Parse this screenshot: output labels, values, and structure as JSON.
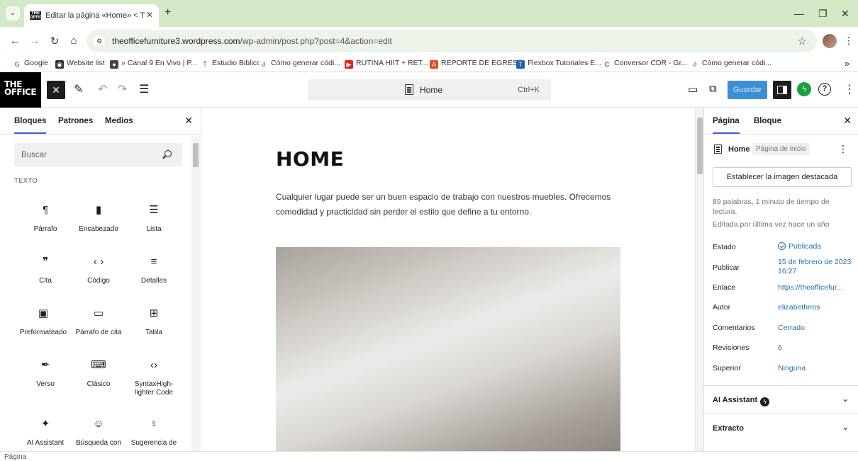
{
  "browser": {
    "tab_title": "Editar la página «Home» < The",
    "favicon_text": "THE OFFICE",
    "url_host": "theofficefurniture3.wordpress.com",
    "url_path": "/wp-admin/post.php?post=4&action=edit",
    "bookmarks": [
      {
        "label": "Google",
        "icon": "google-icon",
        "color": "#4285f4"
      },
      {
        "label": "Website list",
        "icon": "globe-icon",
        "color": "#333333"
      },
      {
        "label": "» Canal 9 En Vivo | P...",
        "icon": "soccer-icon",
        "color": "#444444"
      },
      {
        "label": "Estudio Biblico",
        "icon": "bookmark-icon",
        "color": "#777777"
      },
      {
        "label": "Cómo generar códi...",
        "icon": "link-icon",
        "color": "#555555"
      },
      {
        "label": "RUTINA HIIT + RET...",
        "icon": "youtube-icon",
        "color": "#e62117"
      },
      {
        "label": "REPORTE DE EGRES...",
        "icon": "adobe-icon",
        "color": "#e34826"
      },
      {
        "label": "Flexbox Tutoriales E...",
        "icon": "tl-icon",
        "color": "#1d5fb3"
      },
      {
        "label": "Conversor CDR - Gr...",
        "icon": "c-icon",
        "color": "#d32f2f"
      },
      {
        "label": "Cómo generar códi...",
        "icon": "link-icon",
        "color": "#555555"
      }
    ]
  },
  "editor": {
    "logo_line1": "THE",
    "logo_line2": "OFFICE",
    "command_label": "Home",
    "command_shortcut": "Ctrl+K",
    "save_label": "Guardar"
  },
  "inserter": {
    "tabs": [
      "Bloques",
      "Patrones",
      "Medios"
    ],
    "search_placeholder": "Buscar",
    "section_title": "TEXTO",
    "blocks": [
      {
        "label": "Párrafo",
        "glyph": "¶",
        "icon": "paragraph-icon"
      },
      {
        "label": "Encabezado",
        "glyph": "▮",
        "icon": "heading-icon"
      },
      {
        "label": "Lista",
        "glyph": "☰",
        "icon": "list-icon"
      },
      {
        "label": "Cita",
        "glyph": "❞",
        "icon": "quote-icon"
      },
      {
        "label": "Código",
        "glyph": "‹ ›",
        "icon": "code-icon"
      },
      {
        "label": "Detalles",
        "glyph": "≡",
        "icon": "details-icon"
      },
      {
        "label": "Preformateado",
        "glyph": "▣",
        "icon": "preformatted-icon"
      },
      {
        "label": "Párrafo de cita",
        "glyph": "▭",
        "icon": "pullquote-icon"
      },
      {
        "label": "Tabla",
        "glyph": "⊞",
        "icon": "table-icon"
      },
      {
        "label": "Verso",
        "glyph": "✒",
        "icon": "verse-icon"
      },
      {
        "label": "Clásico",
        "glyph": "⌨",
        "icon": "classic-icon"
      },
      {
        "label": "SyntaxHigh-lighter Code",
        "glyph": "‹›",
        "icon": "syntax-icon"
      },
      {
        "label": "AI Assistant",
        "glyph": "✦",
        "icon": "sparkle-icon"
      },
      {
        "label": "Búsqueda con",
        "glyph": "☺",
        "icon": "robot-icon"
      },
      {
        "label": "Sugerencia de",
        "glyph": "♀",
        "icon": "lightbulb-icon"
      }
    ]
  },
  "canvas": {
    "heading": "HOME",
    "paragraph": "Cualquier lugar puede ser un buen espacio de trabajo con nuestros muebles. Ofrecemos comodidad y practicidad sin perder el estilo que define a tu entorno."
  },
  "settings": {
    "tabs": [
      "Página",
      "Bloque"
    ],
    "post_title": "Home",
    "post_badge": "Página de inicio",
    "featured_button": "Establecer la imagen destacada",
    "word_count": "89 palabras, 1 minuto de tiempo de lectura.",
    "last_edited": "Editada por última vez hace un año",
    "rows": [
      {
        "label": "Estado",
        "value": "Publicada"
      },
      {
        "label": "Publicar",
        "value": "15 de febrero de 2023 16:27"
      },
      {
        "label": "Enlace",
        "value": "https://theofficefur..."
      },
      {
        "label": "Autor",
        "value": "elizabethrms"
      },
      {
        "label": "Comentarios",
        "value": "Cerrado"
      },
      {
        "label": "Revisiones",
        "value": "6"
      },
      {
        "label": "Superior",
        "value": "Ninguna"
      }
    ],
    "sections": [
      "AI Assistant",
      "Extracto"
    ]
  },
  "footer": {
    "breadcrumb": "Página"
  },
  "colors": {
    "tabstrip": "#d3e9c6",
    "accent": "#3858e9",
    "link": "#2271b1",
    "save": "#3c8fd6",
    "jetpack": "#1aa13b"
  }
}
